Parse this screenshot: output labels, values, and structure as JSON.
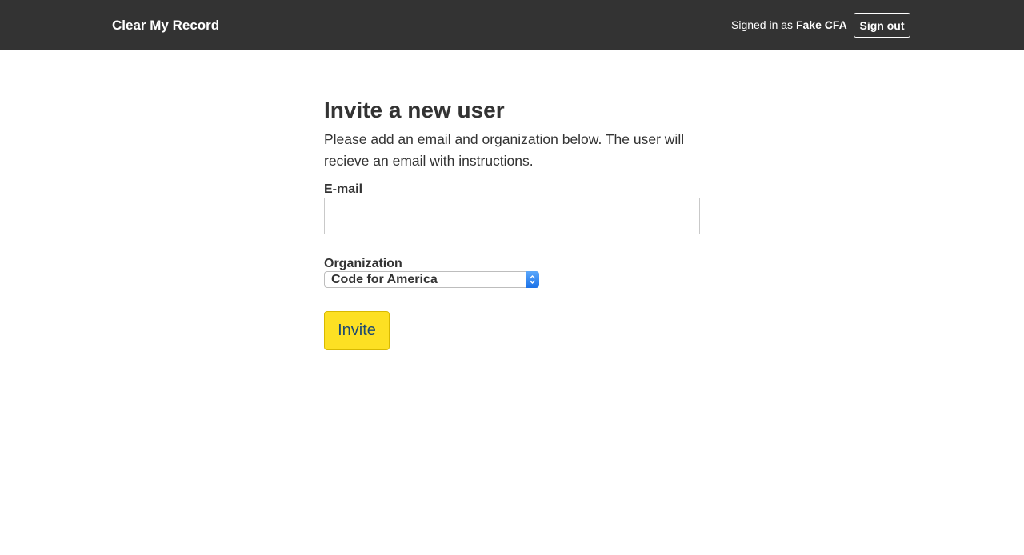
{
  "header": {
    "brand": "Clear My Record",
    "signed_in_prefix": "Signed in as ",
    "signed_in_user": "Fake CFA",
    "sign_out_label": "Sign out",
    "background_color": "#333333"
  },
  "form": {
    "title": "Invite a new user",
    "description": "Please add an email and organization below. The user will recieve an email with instructions.",
    "email_label": "E-mail",
    "email_value": "",
    "organization_label": "Organization",
    "organization_selected": "Code for America",
    "invite_label": "Invite",
    "invite_button_color": "#fde023",
    "invite_text_color": "#1f4b70"
  }
}
